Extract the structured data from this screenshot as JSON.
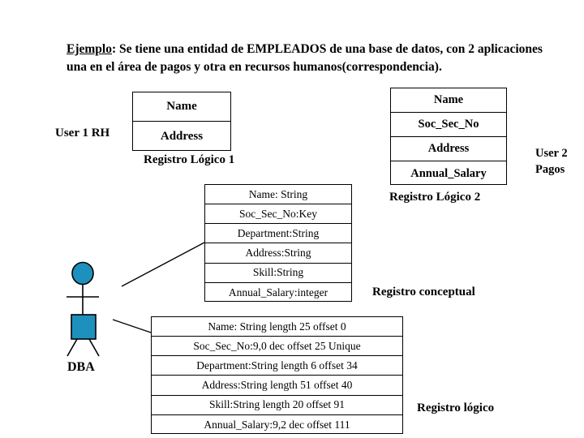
{
  "heading": {
    "keyword": "Ejemplo",
    "line1_rest": ": Se tiene una entidad de EMPLEADOS de una base de datos, con 2",
    "line2": "aplicaciones una en el área de pagos y otra en recursos humanos(correspondencia)."
  },
  "logical_record_1": {
    "user_label": "User 1 RH",
    "caption": "Registro Lógico 1",
    "rows": [
      "Name",
      "Address"
    ]
  },
  "logical_record_2": {
    "user_label_line1": "User 2",
    "user_label_line2": "Pagos",
    "caption": "Registro Lógico 2",
    "rows": [
      "Name",
      "Soc_Sec_No",
      "Address",
      "Annual_Salary"
    ]
  },
  "conceptual_record": {
    "caption": "Registro conceptual",
    "rows": [
      "Name: String",
      "Soc_Sec_No:Key",
      "Department:String",
      "Address:String",
      "Skill:String",
      "Annual_Salary:integer"
    ]
  },
  "physical_record": {
    "caption": "Registro lógico",
    "rows": [
      "Name: String length 25 offset 0",
      "Soc_Sec_No:9,0 dec offset 25 Unique",
      "Department:String length 6 offset 34",
      "Address:String length 51 offset 40",
      "Skill:String length 20 offset 91",
      "Annual_Salary:9,2 dec offset 111"
    ]
  },
  "actor": {
    "label": "DBA",
    "fill_color": "#1E90BE",
    "stroke_color": "#000000"
  },
  "colors": {
    "background": "#FFFFFF",
    "text": "#000000",
    "line": "#000000",
    "actor_fill": "#1E90BE"
  }
}
